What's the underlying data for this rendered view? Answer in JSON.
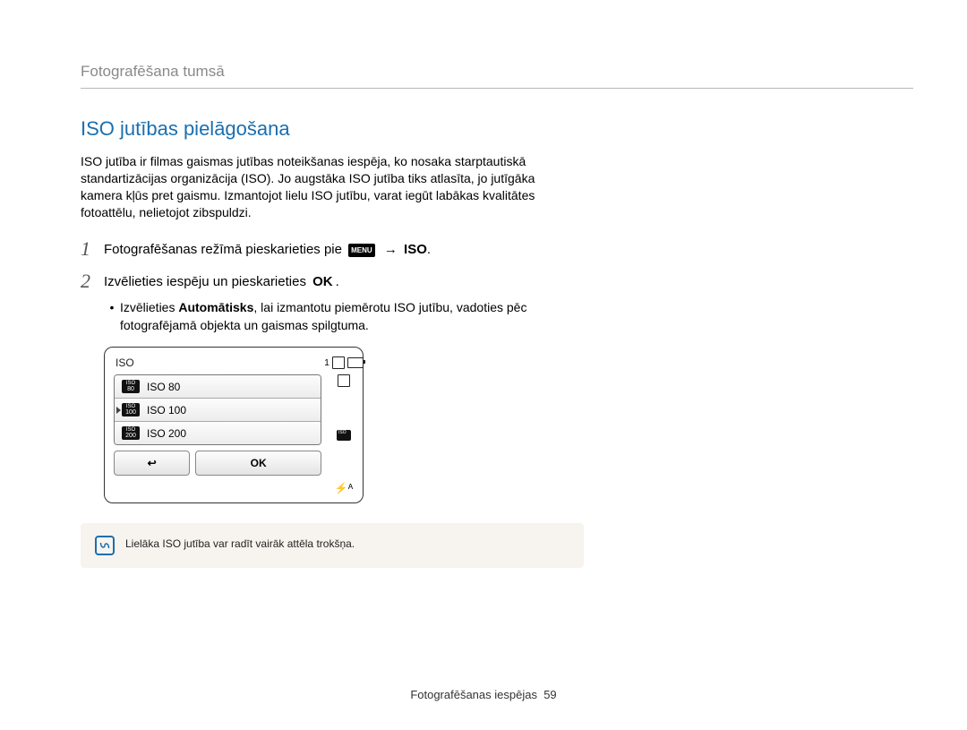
{
  "breadcrumb": "Fotografēšana tumsā",
  "section_title": "ISO jutības pielāgošana",
  "intro": "ISO jutība ir filmas gaismas jutības noteikšanas iespēja, ko nosaka starptautiskā standartizācijas organizācija (ISO). Jo augstāka ISO jutība tiks atlasīta, jo jutīgāka kamera kļūs pret gaismu. Izmantojot lielu ISO jutību, varat iegūt labākas kvalitātes fotoattēlu, nelietojot zibspuldzi.",
  "steps": {
    "s1_a": "Fotografēšanas režīmā pieskarieties pie ",
    "s1_menu": "MENU",
    "s1_arrow": "→",
    "s1_iso": "ISO",
    "s1_dot": ".",
    "s2": "Izvēlieties iespēju un pieskarieties ",
    "s2_ok": "OK",
    "s2_dot": ".",
    "bullet_a": "Izvēlieties ",
    "bullet_bold": "Automātisks",
    "bullet_b": ", lai izmantotu piemērotu ISO jutību, vadoties pēc fotografējamā objekta un gaismas spilgtuma."
  },
  "camera": {
    "title": "ISO",
    "options": [
      {
        "badge_top": "ISO",
        "badge_bot": "80",
        "label": "ISO 80"
      },
      {
        "badge_top": "ISO",
        "badge_bot": "100",
        "label": "ISO 100"
      },
      {
        "badge_top": "ISO",
        "badge_bot": "200",
        "label": "ISO 200"
      }
    ],
    "back": "↩",
    "ok_btn": "OK",
    "counter": "1",
    "flash": "⚡ᴬ"
  },
  "note": "Lielāka ISO jutība var radīt vairāk attēla trokšņa.",
  "footer_label": "Fotografēšanas iespējas",
  "page_number": "59"
}
